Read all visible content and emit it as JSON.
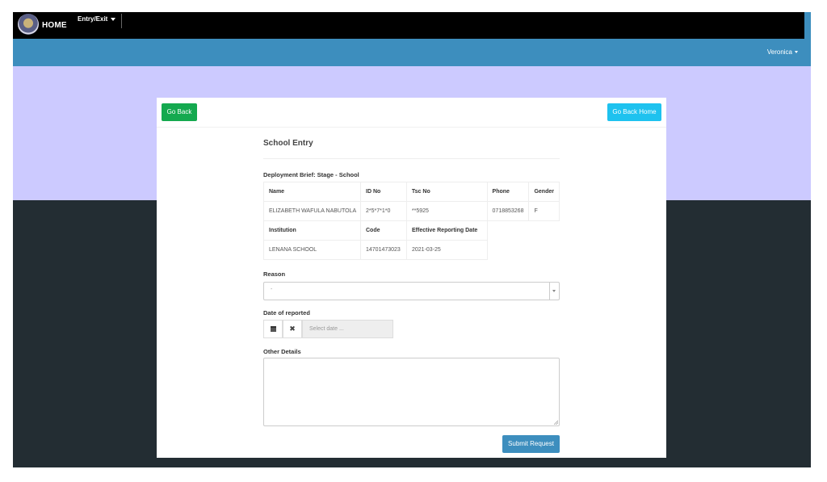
{
  "navbar": {
    "brand_label": "HOME",
    "menu_item": "Entry/Exit",
    "user_name": "Veronica"
  },
  "card": {
    "go_back_label": "Go Back",
    "go_back_home_label": "Go Back Home",
    "title": "School Entry",
    "brief_label": "Deployment Brief: Stage - School",
    "table1": {
      "headers": [
        "Name",
        "ID No",
        "Tsc No",
        "Phone",
        "Gender"
      ],
      "row": [
        "ELIZABETH WAFULA NABUTOLA",
        "2*5*7*1*0",
        "**5925",
        "0718853268",
        "F"
      ]
    },
    "table2": {
      "headers": [
        "Institution",
        "Code",
        "Effective Reporting Date"
      ],
      "row": [
        "LENANA SCHOOL",
        "14701473023",
        "2021-03-25"
      ]
    },
    "reason": {
      "label": "Reason",
      "value": "-"
    },
    "date": {
      "label": "Date of reported",
      "placeholder": "Select date ..."
    },
    "other_details": {
      "label": "Other Details",
      "value": ""
    },
    "submit_label": "Submit Request"
  },
  "colors": {
    "navbar_bg": "#000000",
    "header_blue": "#3d8ebe",
    "lavender": "#cccaff",
    "dark_bg": "#232d33",
    "go_back_green": "#14a94f",
    "go_home_cyan": "#1ec2ef",
    "submit_blue": "#3d8ebe"
  }
}
